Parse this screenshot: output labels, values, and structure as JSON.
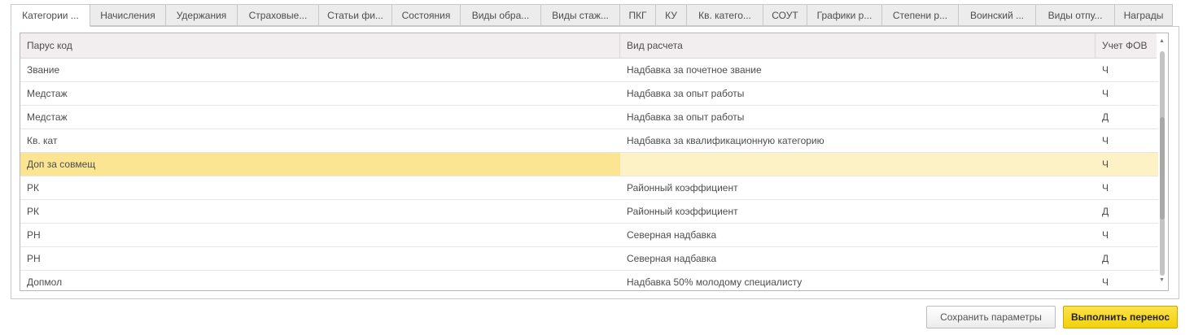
{
  "tabs": [
    "Категории ...",
    "Начисления",
    "Удержания",
    "Страховые...",
    "Статьи фи...",
    "Состояния",
    "Виды обра...",
    "Виды стаж...",
    "ПКГ",
    "КУ",
    "Кв. катего...",
    "СОУТ",
    "Графики р...",
    "Степени р...",
    "Воинский ...",
    "Виды отпу...",
    "Награды"
  ],
  "active_tab": 0,
  "table": {
    "columns": [
      "Парус код",
      "Вид расчета",
      "Учет ФОВ"
    ],
    "rows": [
      [
        "Звание",
        "Надбавка за почетное звание",
        "Ч"
      ],
      [
        "Медстаж",
        "Надбавка за опыт работы",
        "Ч"
      ],
      [
        "Медстаж",
        "Надбавка за опыт работы",
        "Д"
      ],
      [
        "Кв. кат",
        "Надбавка за квалификационную категорию",
        "Ч"
      ],
      [
        "Доп за совмещ",
        "",
        "Ч"
      ],
      [
        "РК",
        "Районный коэффициент",
        "Ч"
      ],
      [
        "РК",
        "Районный коэффициент",
        "Д"
      ],
      [
        "РН",
        "Северная надбавка",
        "Ч"
      ],
      [
        "РН",
        "Северная надбавка",
        "Д"
      ],
      [
        "Допмол",
        "Надбавка 50% молодому специалисту",
        "Ч"
      ]
    ],
    "selected_row": 4
  },
  "buttons": {
    "save": "Сохранить параметры",
    "execute": "Выполнить перенос"
  },
  "colors": {
    "accent": "#f5d60e",
    "selection": "#fce592"
  }
}
